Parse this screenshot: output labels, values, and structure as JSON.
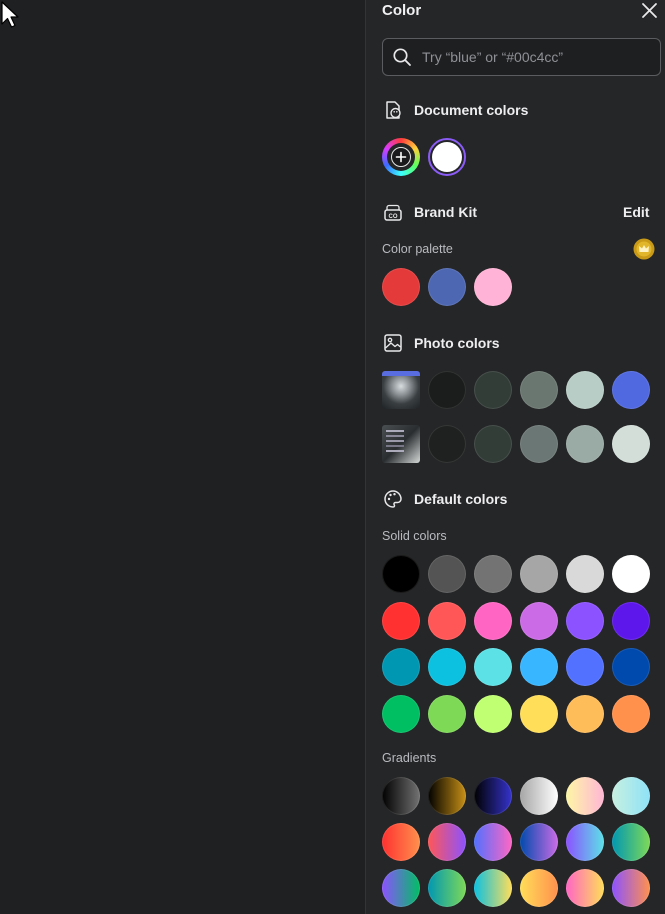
{
  "panel": {
    "title": "Color",
    "icons": {
      "close": "close-icon",
      "search": "search-icon"
    }
  },
  "search": {
    "placeholder": "Try “blue” or “#00c4cc”",
    "value": ""
  },
  "document_colors": {
    "title": "Document colors",
    "icon": "document-palette-icon",
    "swatches": [
      "#ffffff"
    ],
    "selected_color": "#ffffff",
    "selection_ring_color": "#8b5cf6"
  },
  "brand_kit": {
    "title": "Brand Kit",
    "icon": "brand-kit-icon",
    "edit_label": "Edit",
    "palette_label": "Color palette",
    "premium_icon": "crown-icon",
    "swatches": [
      "#e43a3a",
      "#4d67b2",
      "#ffb3d6"
    ]
  },
  "photo_colors": {
    "title": "Photo colors",
    "icon": "image-icon",
    "rows": [
      [
        "#1a1d1c",
        "#333d38",
        "#6a7670",
        "#b9cdc7",
        "#5068e0"
      ],
      [
        "#1f2120",
        "#333d38",
        "#6b7774",
        "#9aaaa4",
        "#d3ded9"
      ]
    ]
  },
  "default_colors": {
    "title": "Default colors",
    "icon": "palette-icon",
    "solid_label": "Solid colors",
    "solid": [
      [
        "#000000",
        "#545454",
        "#737373",
        "#a6a6a6",
        "#d9d9d9",
        "#ffffff"
      ],
      [
        "#ff3131",
        "#ff5757",
        "#ff66c4",
        "#cb6ce6",
        "#8c52ff",
        "#5e17eb"
      ],
      [
        "#0097b2",
        "#0cc0df",
        "#5ce1e6",
        "#38b6ff",
        "#5271ff",
        "#004aad"
      ],
      [
        "#00bf63",
        "#7ed957",
        "#c1ff72",
        "#ffde59",
        "#ffbd59",
        "#ff914d"
      ]
    ],
    "gradients_label": "Gradients",
    "gradients": [
      [
        [
          "#000000",
          "#737373"
        ],
        [
          "#000000",
          "#c89116"
        ],
        [
          "#000000",
          "#3533cd"
        ],
        [
          "#a6a6a6",
          "#ffffff"
        ],
        [
          "#fdf7a5",
          "#ffb6d5"
        ],
        [
          "#c7f0e0",
          "#8ee2f7"
        ]
      ],
      [
        [
          "#ff3131",
          "#ff914d"
        ],
        [
          "#ff5757",
          "#8c52ff"
        ],
        [
          "#5170ff",
          "#ff66c4"
        ],
        [
          "#004aad",
          "#cb6ce6"
        ],
        [
          "#8c52ff",
          "#5ce1e6"
        ],
        [
          "#0097b2",
          "#7ed957"
        ]
      ],
      [
        [
          "#8c52ff",
          "#00bf63"
        ],
        [
          "#0097b2",
          "#7ed957"
        ],
        [
          "#0cc0df",
          "#ffde59"
        ],
        [
          "#ffde59",
          "#ff914d"
        ],
        [
          "#ff66c4",
          "#ffde59"
        ],
        [
          "#8c52ff",
          "#ff914d"
        ]
      ]
    ]
  }
}
